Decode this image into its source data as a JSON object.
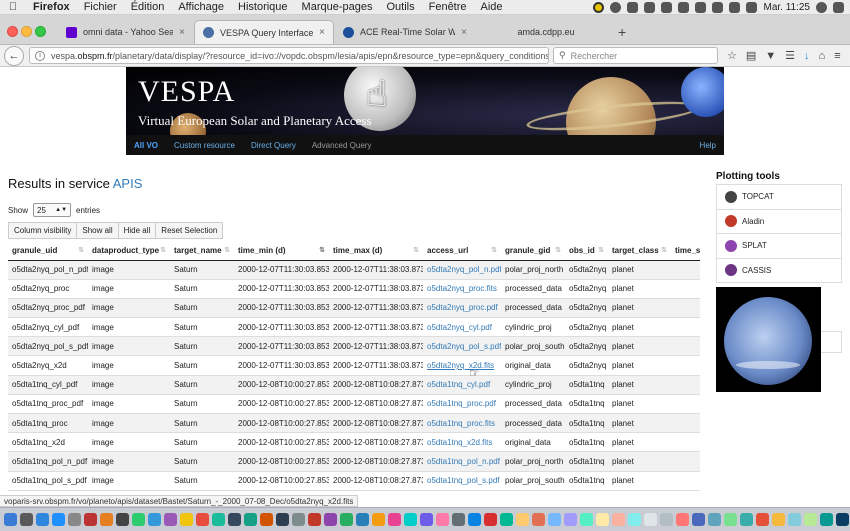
{
  "menubar": {
    "app": "Firefox",
    "items": [
      "Fichier",
      "Édition",
      "Affichage",
      "Historique",
      "Marque-pages",
      "Outils",
      "Fenêtre",
      "Aide"
    ],
    "clock": "Mar. 11:25"
  },
  "tabs": [
    {
      "label": "omni data - Yahoo Search -",
      "favicon_color": "#6001d2"
    },
    {
      "label": "VESPA Query Interface",
      "favicon_color": "#4a6fa5"
    },
    {
      "label": "ACE Real-Time Solar Wind |...",
      "favicon_color": "#1c4f9c"
    },
    {
      "label": "amda.cdpp.eu",
      "favicon_color": ""
    }
  ],
  "nav": {
    "url_domain_prefix": "vespa.",
    "url_domain": "obspm.fr",
    "url_path": "/planetary/data/display/?resource_id=ivo://vopdc.obspm/lesia/apis/epn&resource_type=epn&query_conditions",
    "search_placeholder": "Rechercher"
  },
  "banner": {
    "title": "VESPA",
    "subtitle": "Virtual European Solar and Planetary Access"
  },
  "vonav": {
    "links": [
      "All VO",
      "Custom resource",
      "Direct Query",
      "Advanced Query"
    ],
    "help": "Help"
  },
  "results": {
    "title_prefix": "Results in service ",
    "service": "APIS",
    "show_label": "Show",
    "entries_value": "25",
    "entries_label": "entries"
  },
  "buttons": [
    "Column visibility",
    "Show all",
    "Hide all",
    "Reset Selection"
  ],
  "table": {
    "columns": [
      "granule_uid",
      "dataproduct_type",
      "target_name",
      "time_min (d)",
      "time_max (d)",
      "access_url",
      "granule_gid",
      "obs_id",
      "target_class",
      "time_sa"
    ],
    "rows": [
      [
        "o5dta2nyq_pol_n_pdf",
        "image",
        "Saturn",
        "2000-12-07T11:30:03.853",
        "2000-12-07T11:38:03.873",
        "o5dta2nyq_pol_n.pdf",
        "polar_proj_north",
        "o5dta2nyq",
        "planet",
        ""
      ],
      [
        "o5dta2nyq_proc",
        "image",
        "Saturn",
        "2000-12-07T11:30:03.853",
        "2000-12-07T11:38:03.873",
        "o5dta2nyq_proc.fits",
        "processed_data",
        "o5dta2nyq",
        "planet",
        ""
      ],
      [
        "o5dta2nyq_proc_pdf",
        "image",
        "Saturn",
        "2000-12-07T11:30:03.853",
        "2000-12-07T11:38:03.873",
        "o5dta2nyq_proc.pdf",
        "processed_data",
        "o5dta2nyq",
        "planet",
        ""
      ],
      [
        "o5dta2nyq_cyl_pdf",
        "image",
        "Saturn",
        "2000-12-07T11:30:03.853",
        "2000-12-07T11:38:03.873",
        "o5dta2nyq_cyl.pdf",
        "cylindric_proj",
        "o5dta2nyq",
        "planet",
        ""
      ],
      [
        "o5dta2nyq_pol_s_pdf",
        "image",
        "Saturn",
        "2000-12-07T11:30:03.853",
        "2000-12-07T11:38:03.873",
        "o5dta2nyq_pol_s.pdf",
        "polar_proj_south",
        "o5dta2nyq",
        "planet",
        ""
      ],
      [
        "o5dta2nyq_x2d",
        "image",
        "Saturn",
        "2000-12-07T11:30:03.853",
        "2000-12-07T11:38:03.873",
        "o5dta2nyq_x2d.fits",
        "original_data",
        "o5dta2nyq",
        "planet",
        ""
      ],
      [
        "o5dta1tnq_cyl_pdf",
        "image",
        "Saturn",
        "2000-12-08T10:00:27.853",
        "2000-12-08T10:08:27.873",
        "o5dta1tnq_cyl.pdf",
        "cylindric_proj",
        "o5dta1tnq",
        "planet",
        ""
      ],
      [
        "o5dta1tnq_proc_pdf",
        "image",
        "Saturn",
        "2000-12-08T10:00:27.853",
        "2000-12-08T10:08:27.873",
        "o5dta1tnq_proc.pdf",
        "processed_data",
        "o5dta1tnq",
        "planet",
        ""
      ],
      [
        "o5dta1tnq_proc",
        "image",
        "Saturn",
        "2000-12-08T10:00:27.853",
        "2000-12-08T10:08:27.873",
        "o5dta1tnq_proc.fits",
        "processed_data",
        "o5dta1tnq",
        "planet",
        ""
      ],
      [
        "o5dta1tnq_x2d",
        "image",
        "Saturn",
        "2000-12-08T10:00:27.853",
        "2000-12-08T10:08:27.873",
        "o5dta1tnq_x2d.fits",
        "original_data",
        "o5dta1tnq",
        "planet",
        ""
      ],
      [
        "o5dta1tnq_pol_n_pdf",
        "image",
        "Saturn",
        "2000-12-08T10:00:27.853",
        "2000-12-08T10:08:27.873",
        "o5dta1tnq_pol_n.pdf",
        "polar_proj_north",
        "o5dta1tnq",
        "planet",
        ""
      ],
      [
        "o5dta1tnq_pol_s_pdf",
        "image",
        "Saturn",
        "2000-12-08T10:00:27.853",
        "2000-12-08T10:08:27.873",
        "o5dta1tnq_pol_s.pdf",
        "polar_proj_south",
        "o5dta1tnq",
        "planet",
        ""
      ]
    ]
  },
  "plotting": {
    "title": "Plotting tools",
    "tools": [
      {
        "name": "TOPCAT",
        "color": "#444444"
      },
      {
        "name": "Aladin",
        "color": "#c0392b"
      },
      {
        "name": "SPLAT",
        "color": "#8e44ad"
      },
      {
        "name": "CASSIS",
        "color": "#6c3483"
      }
    ]
  },
  "statusbar": "voparis-srv.obspm.fr/vo/planeto/apis/dataset/Bastet/Saturn_-_2000_07-08_Dec/o5dta2nyq_x2d.fits",
  "dock_colors": [
    "#3a7bd5",
    "#5a5a5a",
    "#2e86de",
    "#1e90ff",
    "#888",
    "#b33",
    "#e67e22",
    "#444",
    "#2ecc71",
    "#3498db",
    "#9b59b6",
    "#f1c40f",
    "#e74c3c",
    "#1abc9c",
    "#34495e",
    "#16a085",
    "#d35400",
    "#2c3e50",
    "#7f8c8d",
    "#c0392b",
    "#8e44ad",
    "#27ae60",
    "#2980b9",
    "#f39c12",
    "#e84393",
    "#00cec9",
    "#6c5ce7",
    "#fd79a8",
    "#636e72",
    "#0984e3",
    "#d63031",
    "#00b894",
    "#fdcb6e",
    "#e17055",
    "#74b9ff",
    "#a29bfe",
    "#55efc4",
    "#ffeaa7",
    "#fab1a0",
    "#81ecec",
    "#dfe6e9",
    "#b2bec3",
    "#ff7675",
    "#4a69bd",
    "#60a3bc",
    "#78e08f",
    "#38ada9",
    "#e55039",
    "#f6b93b",
    "#82ccdd",
    "#b8e994",
    "#079992",
    "#0a3d62",
    "#3c6382"
  ]
}
